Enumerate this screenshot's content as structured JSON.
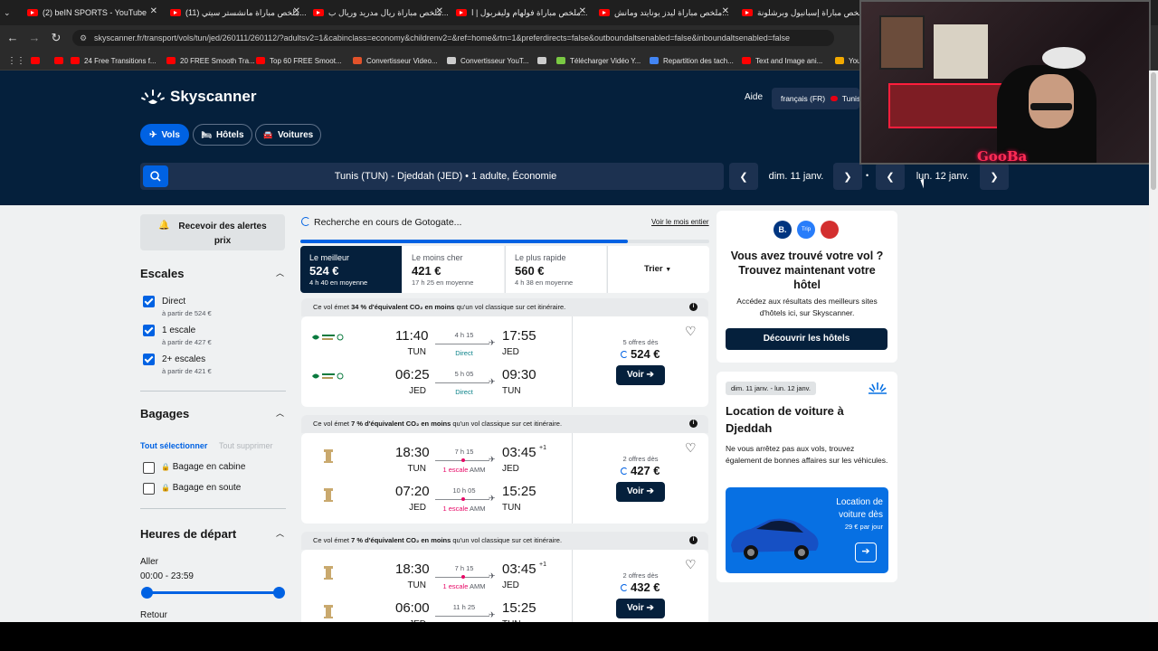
{
  "browser": {
    "tabs": [
      {
        "title": "(2) beIN SPORTS - YouTube"
      },
      {
        "title": "(11) ملخص مباراة مانشستر سيتي..."
      },
      {
        "title": "ملخص مباراة ريال مدريد وريال ب..."
      },
      {
        "title": "ملخص مباراة فولهام وليفربول | ا..."
      },
      {
        "title": "ملخص مباراة ليدز يونايتد ومانش..."
      },
      {
        "title": "ملخص مباراة إسبانيول وبرشلونة"
      }
    ],
    "url": "skyscanner.fr/transport/vols/tun/jed/260111/260112/?adultsv2=1&cabinclass=economy&childrenv2=&ref=home&rtn=1&preferdirects=false&outboundaltsenabled=false&inboundaltsenabled=false",
    "bookmarks": [
      {
        "label": "",
        "color": "#ff0000"
      },
      {
        "label": "",
        "color": "#ff0000"
      },
      {
        "label": "24 Free Transitions f...",
        "color": "#ff0000"
      },
      {
        "label": "20 FREE Smooth Tra...",
        "color": "#ff0000"
      },
      {
        "label": "Top 60 FREE Smoot...",
        "color": "#ff0000"
      },
      {
        "label": "Convertisseur Video...",
        "color": "#e2522a"
      },
      {
        "label": "Convertisseur YouT...",
        "color": "#cccccc"
      },
      {
        "label": "",
        "color": "#cccccc"
      },
      {
        "label": "Télécharger Vidéo Y...",
        "color": "#7ac943"
      },
      {
        "label": "Repartition des tach...",
        "color": "#4285f4"
      },
      {
        "label": "Text and Image ani...",
        "color": "#ff0000"
      },
      {
        "label": "You",
        "color": "#f2a900"
      }
    ]
  },
  "header": {
    "brand": "Skyscanner",
    "help": "Aide",
    "locale": "français (FR)",
    "country": "Tunisi",
    "nav": [
      {
        "label": "Vols",
        "active": true,
        "icon": "plane-icon"
      },
      {
        "label": "Hôtels",
        "active": false,
        "icon": "bed-icon"
      },
      {
        "label": "Voitures",
        "active": false,
        "icon": "car-icon"
      }
    ],
    "search_summary": "Tunis (TUN) - Djeddah (JED)  •  1 adulte, Économie",
    "depart_date": "dim. 11 janv.",
    "separator": "•",
    "return_date": "lun. 12 janv."
  },
  "streamer": {
    "overlay_name": "GooBa"
  },
  "filters": {
    "alerts_button": "Recevoir des alertes prix",
    "stops": {
      "title": "Escales",
      "options": [
        {
          "label": "Direct",
          "from": "à partir de 524 €",
          "checked": true
        },
        {
          "label": "1 escale",
          "from": "à partir de 427 €",
          "checked": true
        },
        {
          "label": "2+ escales",
          "from": "à partir de 421 €",
          "checked": true
        }
      ]
    },
    "baggage": {
      "title": "Bagages",
      "select_all": "Tout sélectionner",
      "clear_all": "Tout supprimer",
      "options": [
        {
          "label": "Bagage en cabine",
          "checked": false
        },
        {
          "label": "Bagage en soute",
          "checked": false
        }
      ]
    },
    "times": {
      "title": "Heures de départ",
      "outbound_label": "Aller",
      "outbound_range": "00:00 - 23:59",
      "return_label": "Retour"
    }
  },
  "results": {
    "searching_text": "Recherche en cours de Gotogate...",
    "view_month": "Voir le mois entier",
    "progress": 0.8,
    "sort_tabs": [
      {
        "label": "Le meilleur",
        "price": "524 €",
        "sub": "4 h 40 en moyenne",
        "active": true
      },
      {
        "label": "Le moins cher",
        "price": "421 €",
        "sub": "17 h 25 en moyenne",
        "active": false
      },
      {
        "label": "Le plus rapide",
        "price": "560 €",
        "sub": "4 h 38 en moyenne",
        "active": false
      }
    ],
    "sort_button": "Trier",
    "cards": [
      {
        "emission_pct": "34 %",
        "emission_before": "Ce vol émet",
        "emission_bold": "d'équivalent CO₂ en moins",
        "emission_after": "qu'un vol classique sur cet itinéraire.",
        "legs": [
          {
            "dep": "11:40",
            "dep_code": "TUN",
            "dur": "4 h 15",
            "stops": "Direct",
            "arr": "17:55",
            "arr_code": "JED",
            "plus": ""
          },
          {
            "dep": "06:25",
            "dep_code": "JED",
            "dur": "5 h 05",
            "stops": "Direct",
            "arr": "09:30",
            "arr_code": "TUN",
            "plus": ""
          }
        ],
        "offers": "5 offres dès",
        "price": "524 €",
        "cta": "Voir",
        "airline": "saudia"
      },
      {
        "emission_pct": "7 %",
        "emission_before": "Ce vol émet",
        "emission_bold": "d'équivalent CO₂ en moins",
        "emission_after": "qu'un vol classique sur cet itinéraire.",
        "legs": [
          {
            "dep": "18:30",
            "dep_code": "TUN",
            "dur": "7 h 15",
            "stops": "1 escale",
            "via": "AMM",
            "arr": "03:45",
            "arr_code": "JED",
            "plus": "+1"
          },
          {
            "dep": "07:20",
            "dep_code": "JED",
            "dur": "10 h 05",
            "stops": "1 escale",
            "via": "AMM",
            "arr": "15:25",
            "arr_code": "TUN",
            "plus": ""
          }
        ],
        "offers": "2 offres dès",
        "price": "427 €",
        "cta": "Voir",
        "airline": "royal-jordanian"
      },
      {
        "emission_pct": "7 %",
        "emission_before": "Ce vol émet",
        "emission_bold": "d'équivalent CO₂ en moins",
        "emission_after": "qu'un vol classique sur cet itinéraire.",
        "legs": [
          {
            "dep": "18:30",
            "dep_code": "TUN",
            "dur": "7 h 15",
            "stops": "1 escale",
            "via": "AMM",
            "arr": "03:45",
            "arr_code": "JED",
            "plus": "+1"
          },
          {
            "dep": "06:00",
            "dep_code": "JED",
            "dur": "11 h 25",
            "stops": "",
            "via": "",
            "arr": "15:25",
            "arr_code": "TUN",
            "plus": ""
          }
        ],
        "offers": "2 offres dès",
        "price": "432 €",
        "cta": "Voir",
        "airline": "royal-jordanian"
      }
    ]
  },
  "ads": {
    "hotel": {
      "title": "Vous avez trouvé votre vol ? Trouvez maintenant votre hôtel",
      "body": "Accédez aux résultats des meilleurs sites d'hôtels ici, sur Skyscanner.",
      "cta": "Découvrir les hôtels",
      "partners": [
        "B.",
        "Trip",
        ""
      ]
    },
    "car": {
      "dates": "dim. 11 janv. - lun. 12 janv.",
      "title": "Location de voiture à Djeddah",
      "body": "Ne vous arrêtez pas aux vols, trouvez également de bonnes affaires sur les véhicules.",
      "promo_title": "Location de voiture dès",
      "promo_price": "29 € par jour"
    }
  },
  "colors": {
    "navy": "#05203c",
    "brand_blue": "#0062e3",
    "direct_green": "#0c838a",
    "stop_pink": "#e70866"
  }
}
